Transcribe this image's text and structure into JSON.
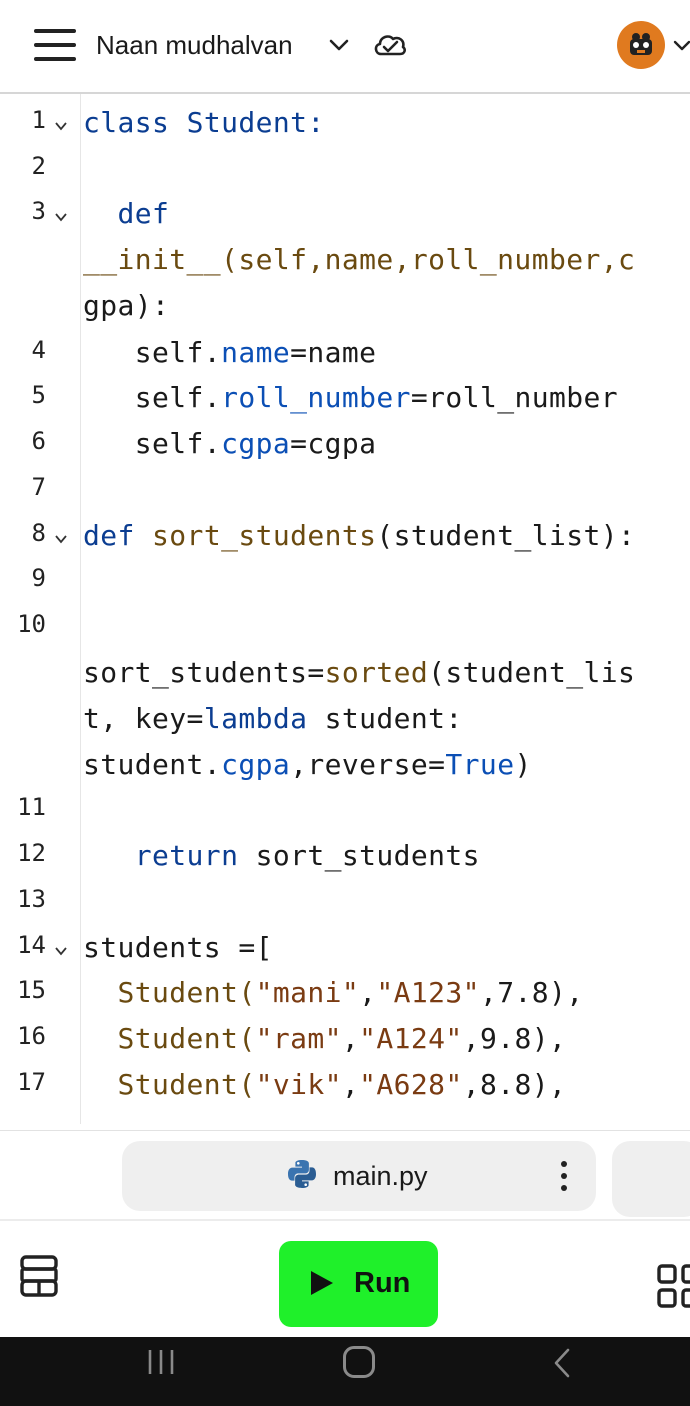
{
  "header": {
    "project_title": "Naan mudhalvan",
    "menu_icon": "hamburger-menu-icon",
    "dropdown_icon": "chevron-down-icon",
    "sync_icon": "cloud-check-icon",
    "avatar_icon": "user-avatar-icon"
  },
  "editor": {
    "line_numbers": [
      "1",
      "2",
      "3",
      "4",
      "5",
      "6",
      "7",
      "8",
      "9",
      "10",
      "11",
      "12",
      "13",
      "14",
      "15",
      "16",
      "17"
    ],
    "code": {
      "l1_kw": "class",
      "l1_name": "Student",
      "l1_tail": ":",
      "l3_kw": "def",
      "l3a": "__init__(self,name,roll_number,c",
      "l3b": "gpa):",
      "l4_self": "self.",
      "l4_attr": "name",
      "l4_tail": "=name",
      "l5_self": "self.",
      "l5_attr": "roll_number",
      "l5_tail": "=roll_number",
      "l6_self": "self.",
      "l6_attr": "cgpa",
      "l6_tail": "=cgpa",
      "l8_kw": "def",
      "l8_fn": "sort_students",
      "l8_tail": "(student_list):",
      "l10a_pre": "sort_students=",
      "l10a_fn": "sorted",
      "l10a_tail": "(student_lis",
      "l10b_pre": "t, key=",
      "l10b_kw": "lambda",
      "l10b_tail": " student:",
      "l10c_pre": "student.",
      "l10c_attr": "cgpa",
      "l10c_mid": ",reverse=",
      "l10c_bool": "True",
      "l10c_tail": ")",
      "l12_kw": "return",
      "l12_tail": " sort_students",
      "l14": "students =[",
      "l15_cls": "Student(",
      "l15_s1": "\"mani\"",
      "l15_c1": ",",
      "l15_s2": "\"A123\"",
      "l15_tail": ",7.8),",
      "l16_cls": "Student(",
      "l16_s1": "\"ram\"",
      "l16_c1": ",",
      "l16_s2": "\"A124\"",
      "l16_tail": ",9.8),",
      "l17_cls": "Student(",
      "l17_s1": "\"vik\"",
      "l17_c1": ",",
      "l17_s2": "\"A628\"",
      "l17_tail": ",8.8),"
    }
  },
  "tabs": {
    "active_file": "main.py",
    "file_icon": "python-icon",
    "menu_icon": "kebab-menu-icon"
  },
  "toolbar": {
    "run_label": "Run",
    "left_icon": "layers-icon",
    "right_icon": "grid-icon"
  },
  "colors": {
    "run_button": "#1ff02a",
    "keyword": "#0b3d91",
    "function": "#6a4a10",
    "string": "#7a3b12",
    "avatar": "#e07a1f"
  }
}
